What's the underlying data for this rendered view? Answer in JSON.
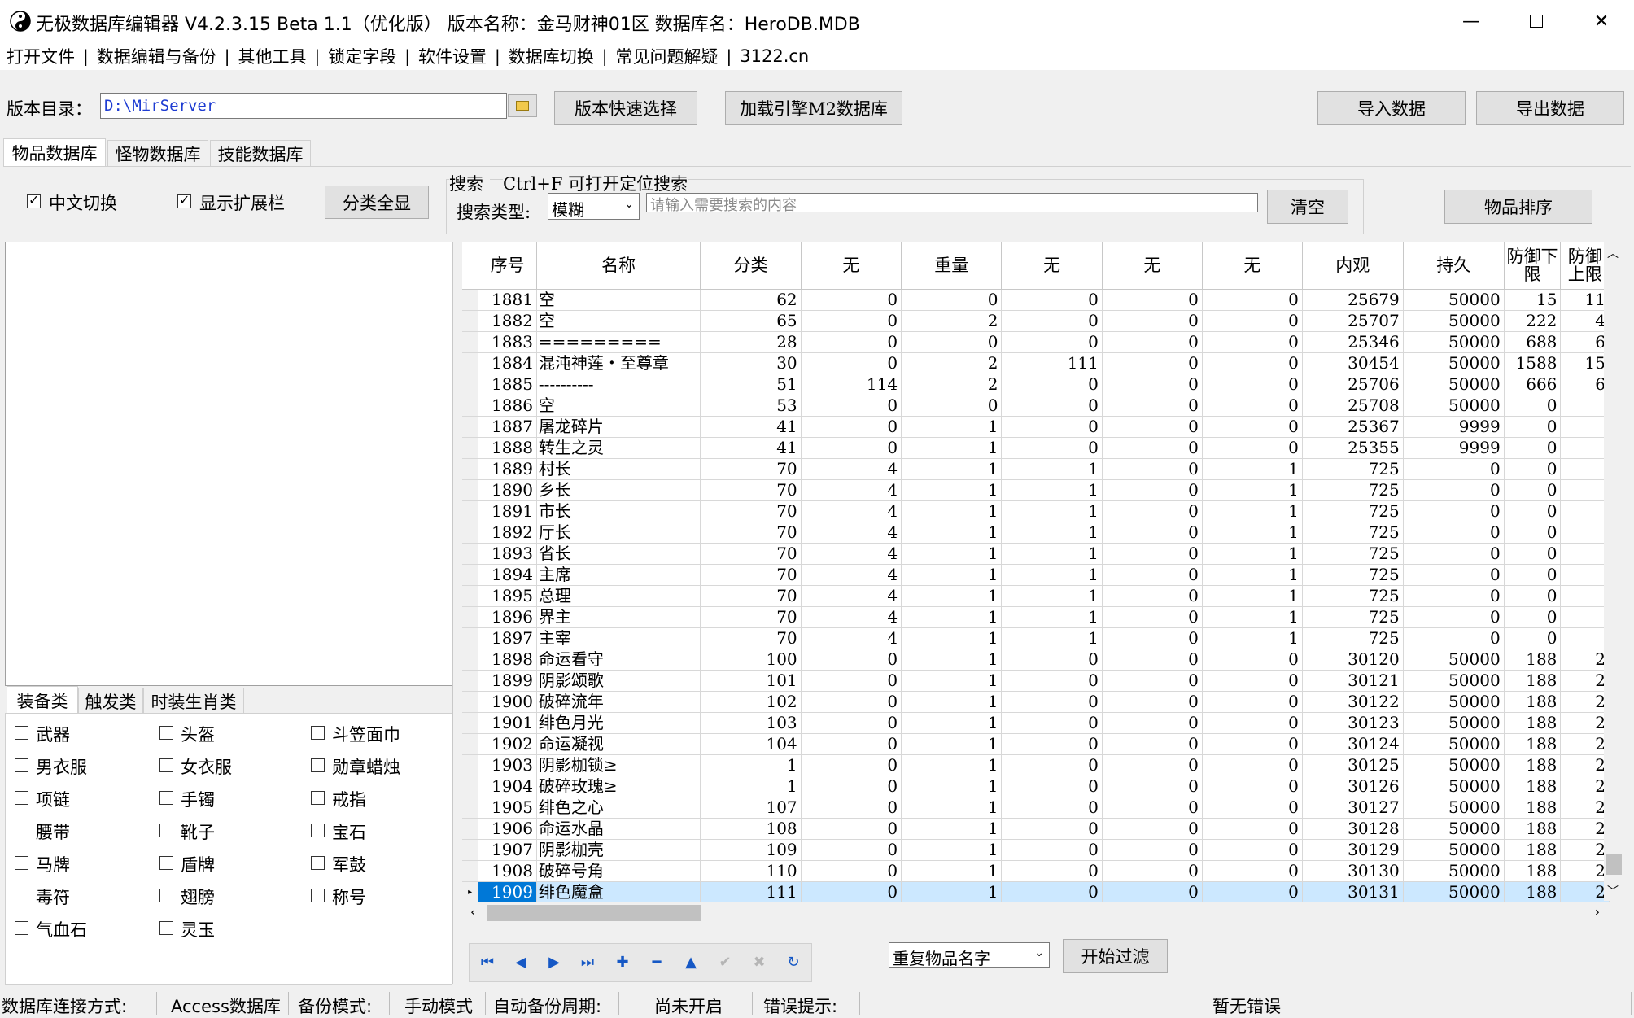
{
  "window": {
    "title": "无极数据库编辑器 V4.2.3.15    Beta 1.1（优化版）    版本名称：金马财神01区    数据库名：HeroDB.MDB"
  },
  "menu": [
    "打开文件",
    "数据编辑与备份",
    "其他工具",
    "锁定字段",
    "软件设置",
    "数据库切换",
    "常见问题解疑",
    "3122.cn"
  ],
  "toolbar": {
    "version_dir_label": "版本目录：",
    "version_dir_value": "D:\\MirServer",
    "quick_select": "版本快速选择",
    "load_m2": "加载引擎M2数据库",
    "import": "导入数据",
    "export": "导出数据"
  },
  "db_tabs": [
    "物品数据库",
    "怪物数据库",
    "技能数据库"
  ],
  "options": {
    "chinese_switch": "中文切换",
    "show_ext": "显示扩展栏",
    "show_all": "分类全显"
  },
  "search": {
    "title": "搜索",
    "hint": "Ctrl+F 可打开定位搜索",
    "type_label": "搜索类型:",
    "type_value": "模糊",
    "placeholder": "请输入需要搜索的内容",
    "clear": "清空",
    "sort": "物品排序"
  },
  "category_tabs": [
    "装备类",
    "触发类",
    "时装生肖类"
  ],
  "categories": [
    [
      "武器",
      "头盔",
      "斗笠面巾"
    ],
    [
      "男衣服",
      "女衣服",
      "勋章蜡烛"
    ],
    [
      "项链",
      "手镯",
      "戒指"
    ],
    [
      "腰带",
      "靴子",
      "宝石"
    ],
    [
      "马牌",
      "盾牌",
      "军鼓"
    ],
    [
      "毒符",
      "翅膀",
      "称号"
    ],
    [
      "气血石",
      "灵玉",
      ""
    ]
  ],
  "grid": {
    "columns": [
      "序号",
      "名称",
      "分类",
      "无",
      "重量",
      "无",
      "无",
      "无",
      "内观",
      "持久",
      "防御下限",
      "防御上限"
    ],
    "rows": [
      [
        "1881",
        "空",
        "62",
        "0",
        "0",
        "0",
        "0",
        "0",
        "25679",
        "50000",
        "15",
        "11"
      ],
      [
        "1882",
        "空",
        "65",
        "0",
        "2",
        "0",
        "0",
        "0",
        "25707",
        "50000",
        "222",
        "4"
      ],
      [
        "1883",
        "=========",
        "28",
        "0",
        "0",
        "0",
        "0",
        "0",
        "25346",
        "50000",
        "688",
        "6"
      ],
      [
        "1884",
        "混沌神莲・至尊章",
        "30",
        "0",
        "2",
        "111",
        "0",
        "0",
        "30454",
        "50000",
        "1588",
        "15"
      ],
      [
        "1885",
        "----------",
        "51",
        "114",
        "2",
        "0",
        "0",
        "0",
        "25706",
        "50000",
        "666",
        "6"
      ],
      [
        "1886",
        "空",
        "53",
        "0",
        "0",
        "0",
        "0",
        "0",
        "25708",
        "50000",
        "0",
        ""
      ],
      [
        "1887",
        "屠龙碎片",
        "41",
        "0",
        "1",
        "0",
        "0",
        "0",
        "25367",
        "9999",
        "0",
        ""
      ],
      [
        "1888",
        "转生之灵",
        "41",
        "0",
        "1",
        "0",
        "0",
        "0",
        "25355",
        "9999",
        "0",
        ""
      ],
      [
        "1889",
        "村长",
        "70",
        "4",
        "1",
        "1",
        "0",
        "1",
        "725",
        "0",
        "0",
        ""
      ],
      [
        "1890",
        "乡长",
        "70",
        "4",
        "1",
        "1",
        "0",
        "1",
        "725",
        "0",
        "0",
        ""
      ],
      [
        "1891",
        "市长",
        "70",
        "4",
        "1",
        "1",
        "0",
        "1",
        "725",
        "0",
        "0",
        ""
      ],
      [
        "1892",
        "厅长",
        "70",
        "4",
        "1",
        "1",
        "0",
        "1",
        "725",
        "0",
        "0",
        ""
      ],
      [
        "1893",
        "省长",
        "70",
        "4",
        "1",
        "1",
        "0",
        "1",
        "725",
        "0",
        "0",
        ""
      ],
      [
        "1894",
        "主席",
        "70",
        "4",
        "1",
        "1",
        "0",
        "1",
        "725",
        "0",
        "0",
        ""
      ],
      [
        "1895",
        "总理",
        "70",
        "4",
        "1",
        "1",
        "0",
        "1",
        "725",
        "0",
        "0",
        ""
      ],
      [
        "1896",
        "界主",
        "70",
        "4",
        "1",
        "1",
        "0",
        "1",
        "725",
        "0",
        "0",
        ""
      ],
      [
        "1897",
        "主宰",
        "70",
        "4",
        "1",
        "1",
        "0",
        "1",
        "725",
        "0",
        "0",
        ""
      ],
      [
        "1898",
        "命运看守",
        "100",
        "0",
        "1",
        "0",
        "0",
        "0",
        "30120",
        "50000",
        "188",
        "2"
      ],
      [
        "1899",
        "阴影颂歌",
        "101",
        "0",
        "1",
        "0",
        "0",
        "0",
        "30121",
        "50000",
        "188",
        "2"
      ],
      [
        "1900",
        "破碎流年",
        "102",
        "0",
        "1",
        "0",
        "0",
        "0",
        "30122",
        "50000",
        "188",
        "2"
      ],
      [
        "1901",
        "绯色月光",
        "103",
        "0",
        "1",
        "0",
        "0",
        "0",
        "30123",
        "50000",
        "188",
        "2"
      ],
      [
        "1902",
        "命运凝视",
        "104",
        "0",
        "1",
        "0",
        "0",
        "0",
        "30124",
        "50000",
        "188",
        "2"
      ],
      [
        "1903",
        "阴影枷锁≥",
        "1",
        "0",
        "1",
        "0",
        "0",
        "0",
        "30125",
        "50000",
        "188",
        "2"
      ],
      [
        "1904",
        "破碎玫瑰≥",
        "1",
        "0",
        "1",
        "0",
        "0",
        "0",
        "30126",
        "50000",
        "188",
        "2"
      ],
      [
        "1905",
        "绯色之心",
        "107",
        "0",
        "1",
        "0",
        "0",
        "0",
        "30127",
        "50000",
        "188",
        "2"
      ],
      [
        "1906",
        "命运水晶",
        "108",
        "0",
        "1",
        "0",
        "0",
        "0",
        "30128",
        "50000",
        "188",
        "2"
      ],
      [
        "1907",
        "阴影枷壳",
        "109",
        "0",
        "1",
        "0",
        "0",
        "0",
        "30129",
        "50000",
        "188",
        "2"
      ],
      [
        "1908",
        "破碎号角",
        "110",
        "0",
        "1",
        "0",
        "0",
        "0",
        "30130",
        "50000",
        "188",
        "2"
      ],
      [
        "1909",
        "绯色魔盒",
        "111",
        "0",
        "1",
        "0",
        "0",
        "0",
        "30131",
        "50000",
        "188",
        "2"
      ]
    ]
  },
  "filter": {
    "type_value": "重复物品名字",
    "start": "开始过滤"
  },
  "status": {
    "conn_label": "数据库连接方式:",
    "conn_value": "Access数据库",
    "backup_label": "备份模式:",
    "backup_value": "手动模式",
    "auto_label": "自动备份周期:",
    "auto_value": "尚未开启",
    "error_label": "错误提示:",
    "error_value": "暂无错误"
  }
}
